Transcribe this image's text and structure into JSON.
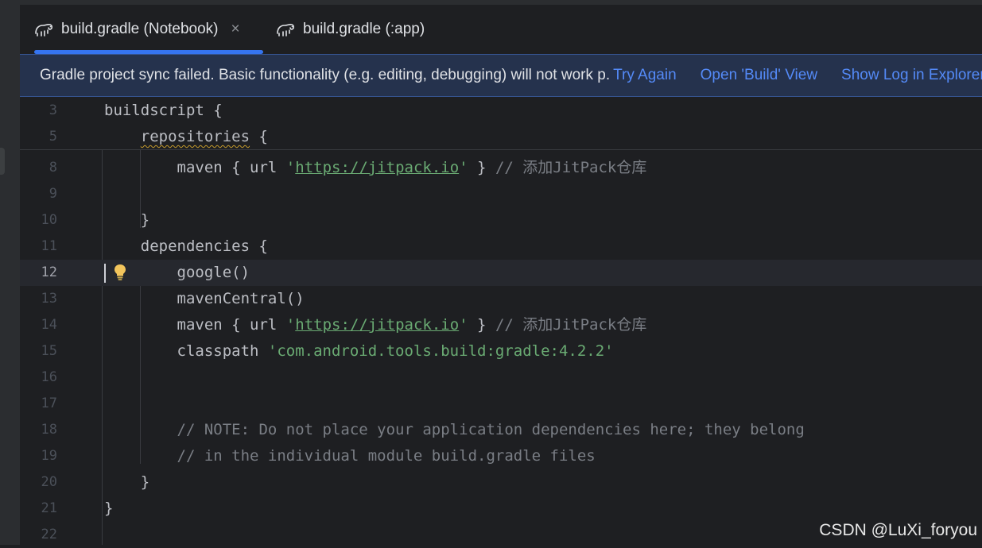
{
  "tabs": [
    {
      "label": "build.gradle (Notebook)",
      "icon": "gradle-elephant-icon",
      "active": true,
      "close": "×"
    },
    {
      "label": "build.gradle (:app)",
      "icon": "gradle-elephant-icon",
      "active": false
    }
  ],
  "banner": {
    "message": "Gradle project sync failed. Basic functionality (e.g. editing, debugging) will not work p.",
    "try_again": "Try Again",
    "open_build": "Open 'Build' View",
    "show_log": "Show Log in Explorer"
  },
  "editor": {
    "current_line": 12,
    "lines": [
      {
        "n": "3"
      },
      {
        "n": "5"
      },
      {
        "n": "8"
      },
      {
        "n": "9"
      },
      {
        "n": "10"
      },
      {
        "n": "11"
      },
      {
        "n": "12"
      },
      {
        "n": "13"
      },
      {
        "n": "14"
      },
      {
        "n": "15"
      },
      {
        "n": "16"
      },
      {
        "n": "17"
      },
      {
        "n": "18"
      },
      {
        "n": "19"
      },
      {
        "n": "20"
      },
      {
        "n": "21"
      },
      {
        "n": "22"
      }
    ],
    "text": {
      "buildscript_open": "buildscript {",
      "repositories": "repositories",
      "brace_open": " {",
      "maven_prefix": "maven { url ",
      "quote": "'",
      "jitpack_url": "https://jitpack.io",
      "maven_suffix": " } ",
      "jitpack_comment": "// 添加JitPack仓库",
      "brace_close": "}",
      "dependencies_open": "dependencies {",
      "google": "google()",
      "maven_central": "mavenCentral()",
      "classpath_prefix": "classpath ",
      "classpath_value": "'com.android.tools.build:gradle:4.2.2'",
      "note_comment_1": "// NOTE: Do not place your application dependencies here; they belong",
      "note_comment_2": "// in the individual module build.gradle files"
    }
  },
  "watermark": "CSDN @LuXi_foryou",
  "colors": {
    "background": "#1e1f22",
    "accent": "#3574f0",
    "link": "#548af7",
    "string": "#6aab73",
    "comment": "#7a7e85",
    "warning_squiggle": "#c39a2c",
    "bulb": "#f2c55c"
  }
}
